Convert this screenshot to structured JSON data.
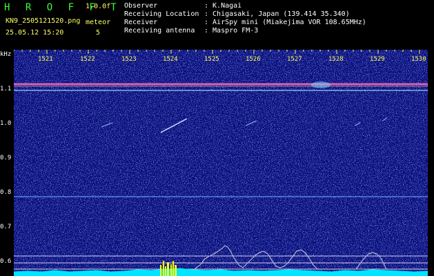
{
  "header": {
    "title": "H R O F F T",
    "version": "1.0.0f",
    "filename": "KN9_2505121520.png",
    "datetime": "25.05.12 15:20",
    "meteor_label": "meteor",
    "meteor_count": "5",
    "fields": [
      {
        "label": "Observer",
        "value": ": K.Nagai"
      },
      {
        "label": "Receiving Location",
        "value": ": Chigasaki, Japan (139.414 35.340)"
      },
      {
        "label": "Receiver",
        "value": ": AirSpy mini (Miakejima VOR 108.65MHz)"
      },
      {
        "label": "Receiving antenna",
        "value": ": Maspro FM-3"
      }
    ]
  },
  "axes": {
    "y_unit": "kHz",
    "y_ticks": [
      "1.1",
      "1.0",
      "0.9",
      "0.8",
      "0.7",
      "0.6"
    ],
    "x_ticks": [
      "1521",
      "1522",
      "1523",
      "1524",
      "1525",
      "1526",
      "1527",
      "1528",
      "1529",
      "1530"
    ]
  },
  "colors": {
    "background": "#0a0f7a",
    "carrier": "#ff66cc",
    "meteor": "#cfe8ff",
    "signal_floor": "#00e5ff",
    "burst": "#ffff00"
  }
}
